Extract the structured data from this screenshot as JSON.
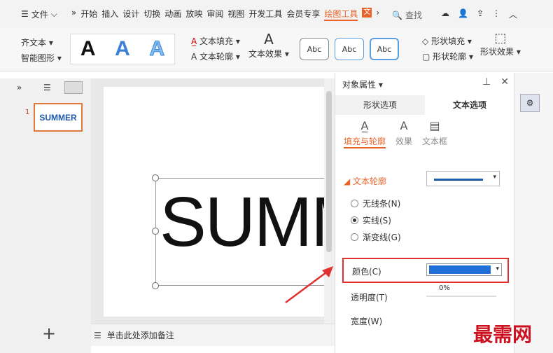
{
  "menubar": {
    "file": "文件",
    "tabs": [
      "开始",
      "插入",
      "设计",
      "切换",
      "动画",
      "放映",
      "审阅",
      "视图",
      "开发工具",
      "会员专享"
    ],
    "active_tab": "绘图工具",
    "search": "查找"
  },
  "ribbon": {
    "align_text": "齐文本",
    "smart_shape": "智能图形",
    "text_fill": "文本填充",
    "text_outline": "文本轮廓",
    "text_effect": "文本效果",
    "abc": [
      "Abc",
      "Abc",
      "Abc"
    ],
    "shape_fill": "形状填充",
    "shape_outline": "形状轮廓",
    "shape_effect": "形状效果"
  },
  "thumbs": {
    "num": "1",
    "text": "SUMMER"
  },
  "slide": {
    "text": "SUMMER"
  },
  "notes": {
    "placeholder": "单击此处添加备注"
  },
  "panel": {
    "title": "对象属性",
    "tab_shape": "形状选项",
    "tab_text": "文本选项",
    "sub_fill": "填充与轮廓",
    "sub_effect": "效果",
    "sub_textbox": "文本框",
    "outline_title": "文本轮廓",
    "radio_none": "无线条(N)",
    "radio_solid": "实线(S)",
    "radio_gradient": "渐变线(G)",
    "color_label": "颜色(C)",
    "transparency": "透明度(T)",
    "percent": "0%",
    "width": "宽度(W)",
    "line_color": "#1f6fd6"
  },
  "watermark": "最需网"
}
